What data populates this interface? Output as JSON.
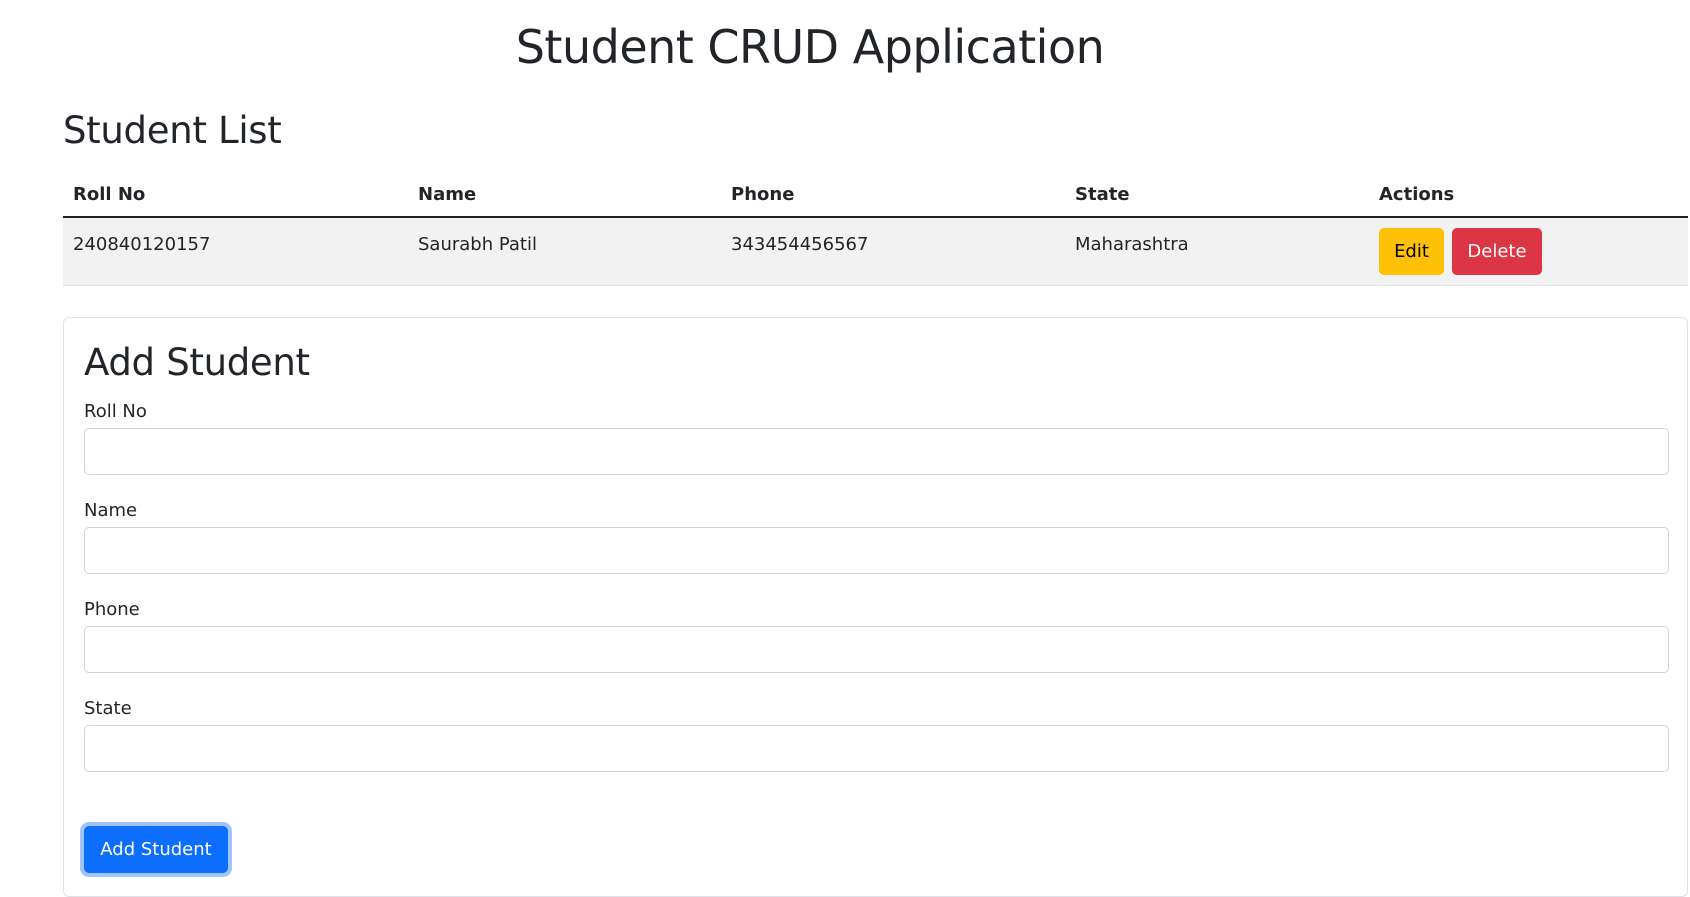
{
  "header": {
    "title": "Student CRUD Application"
  },
  "student_list": {
    "title": "Student List",
    "columns": [
      "Roll No",
      "Name",
      "Phone",
      "State",
      "Actions"
    ],
    "rows": [
      {
        "roll_no": "240840120157",
        "name": "Saurabh Patil",
        "phone": "343454456567",
        "state": "Maharashtra",
        "edit_label": "Edit",
        "delete_label": "Delete"
      }
    ]
  },
  "add_form": {
    "title": "Add Student",
    "fields": [
      {
        "label": "Roll No",
        "value": ""
      },
      {
        "label": "Name",
        "value": ""
      },
      {
        "label": "Phone",
        "value": ""
      },
      {
        "label": "State",
        "value": ""
      }
    ],
    "submit_label": "Add Student"
  },
  "colors": {
    "edit_button": "#ffc107",
    "delete_button": "#dc3545",
    "primary_button": "#0d6efd",
    "row_background": "#f2f2f2"
  }
}
